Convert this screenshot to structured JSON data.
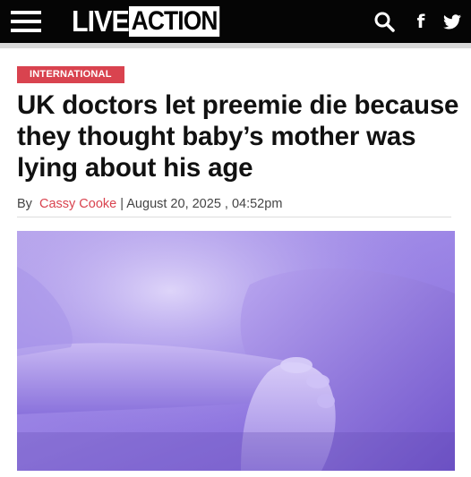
{
  "header": {
    "logo_live": "LIVE",
    "logo_action": "ACTION",
    "icons": {
      "menu": "hamburger-icon",
      "search": "search-icon",
      "facebook": "facebook-icon",
      "twitter": "twitter-icon"
    },
    "facebook_glyph": "f"
  },
  "article": {
    "category": "INTERNATIONAL",
    "title": "UK doctors let preemie die because they thought baby’s mother was lying about his age",
    "byline_prefix": "By",
    "author": "Cassy Cooke",
    "byline_separator": "|",
    "date": "August 20, 2025 , 04:52pm"
  },
  "colors": {
    "accent": "#d9434f",
    "topbar": "#050505",
    "hero_tint": "#9d87e6"
  }
}
